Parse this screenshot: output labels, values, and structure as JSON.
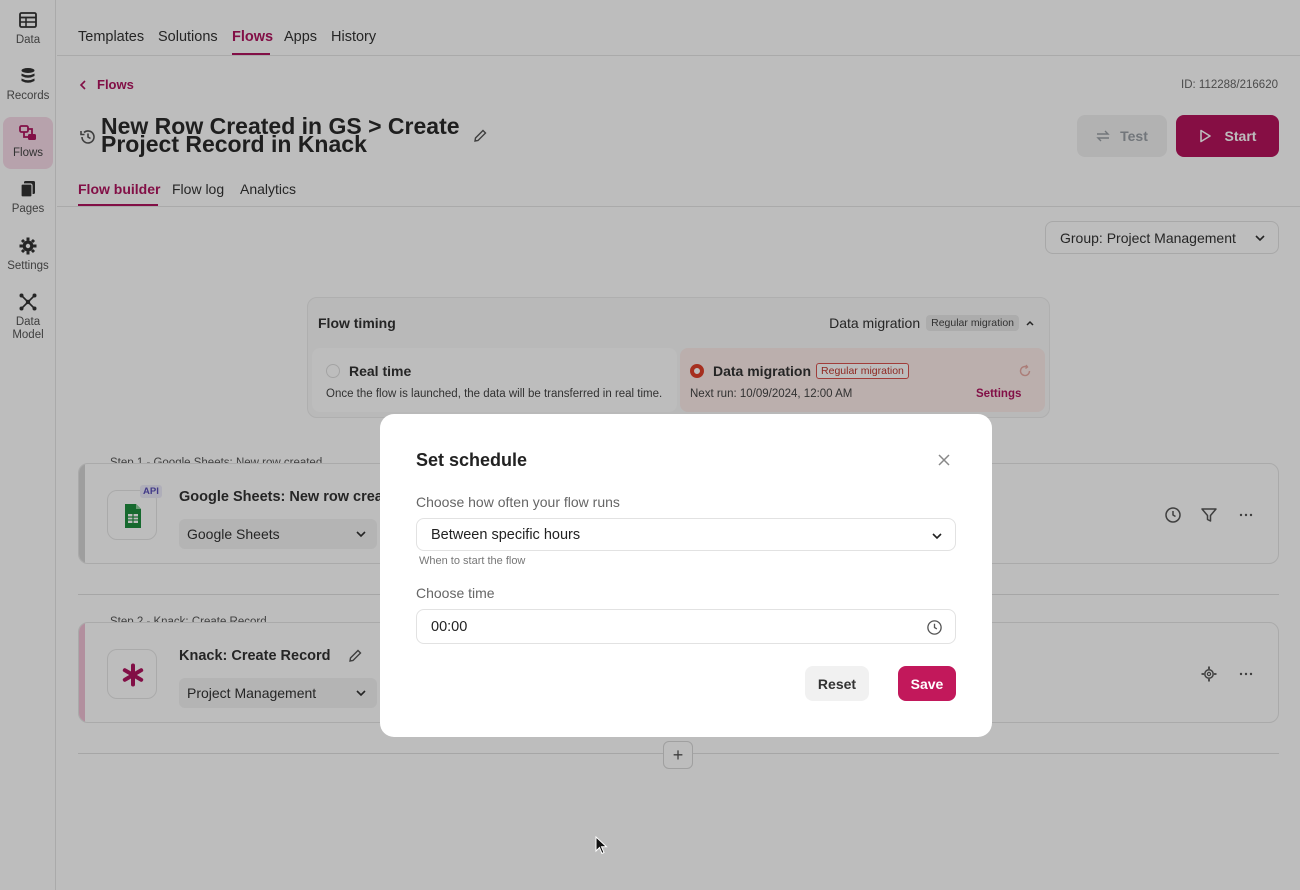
{
  "sidebar": {
    "items": [
      {
        "label": "Data",
        "icon": "table-icon"
      },
      {
        "label": "Records",
        "icon": "database-icon"
      },
      {
        "label": "Flows",
        "icon": "flows-icon",
        "active": true
      },
      {
        "label": "Pages",
        "icon": "pages-icon"
      },
      {
        "label": "Settings",
        "icon": "gear-icon"
      },
      {
        "label": "Data Model",
        "icon": "data-model-icon"
      }
    ]
  },
  "topnav": {
    "tabs": [
      "Templates",
      "Solutions",
      "Flows",
      "Apps",
      "History"
    ],
    "active": "Flows"
  },
  "header": {
    "back_label": "Flows",
    "id_text": "ID: 112288/216620",
    "title_line1": "New Row Created in GS > Create",
    "title_line2": "Project Record in Knack",
    "test_label": "Test",
    "start_label": "Start"
  },
  "subtabs": [
    "Flow builder",
    "Flow log",
    "Analytics"
  ],
  "group_select": "Group: Project Management",
  "flow_timing": {
    "header": "Flow timing",
    "current_mode": "Data migration",
    "current_chip": "Regular migration",
    "realtime": {
      "title": "Real time",
      "desc": "Once the flow is launched, the data will be transferred in real time."
    },
    "migration": {
      "title": "Data migration",
      "chip": "Regular migration",
      "next_run": "Next run: 10/09/2024, 12:00 AM",
      "settings_label": "Settings"
    }
  },
  "steps": [
    {
      "label": "Step 1 - Google Sheets: New row created",
      "name": "Google Sheets: New row create",
      "badge": "API",
      "select_value": "Google Sheets"
    },
    {
      "label": "Step 2 - Knack: Create Record",
      "name": "Knack: Create Record",
      "select_value": "Project Management"
    }
  ],
  "modal": {
    "title": "Set schedule",
    "frequency_label": "Choose how often your flow runs",
    "frequency_value": "Between specific hours",
    "frequency_hint": "When to start the flow",
    "time_label": "Choose time",
    "time_value": "00:00",
    "reset_label": "Reset",
    "save_label": "Save"
  },
  "colors": {
    "accent": "#b0155f",
    "accent_button": "#c2185b",
    "active_sidebar_bg": "#f7dbe9",
    "migration_bg": "#fcecea",
    "radio_selected": "#e0402a"
  }
}
